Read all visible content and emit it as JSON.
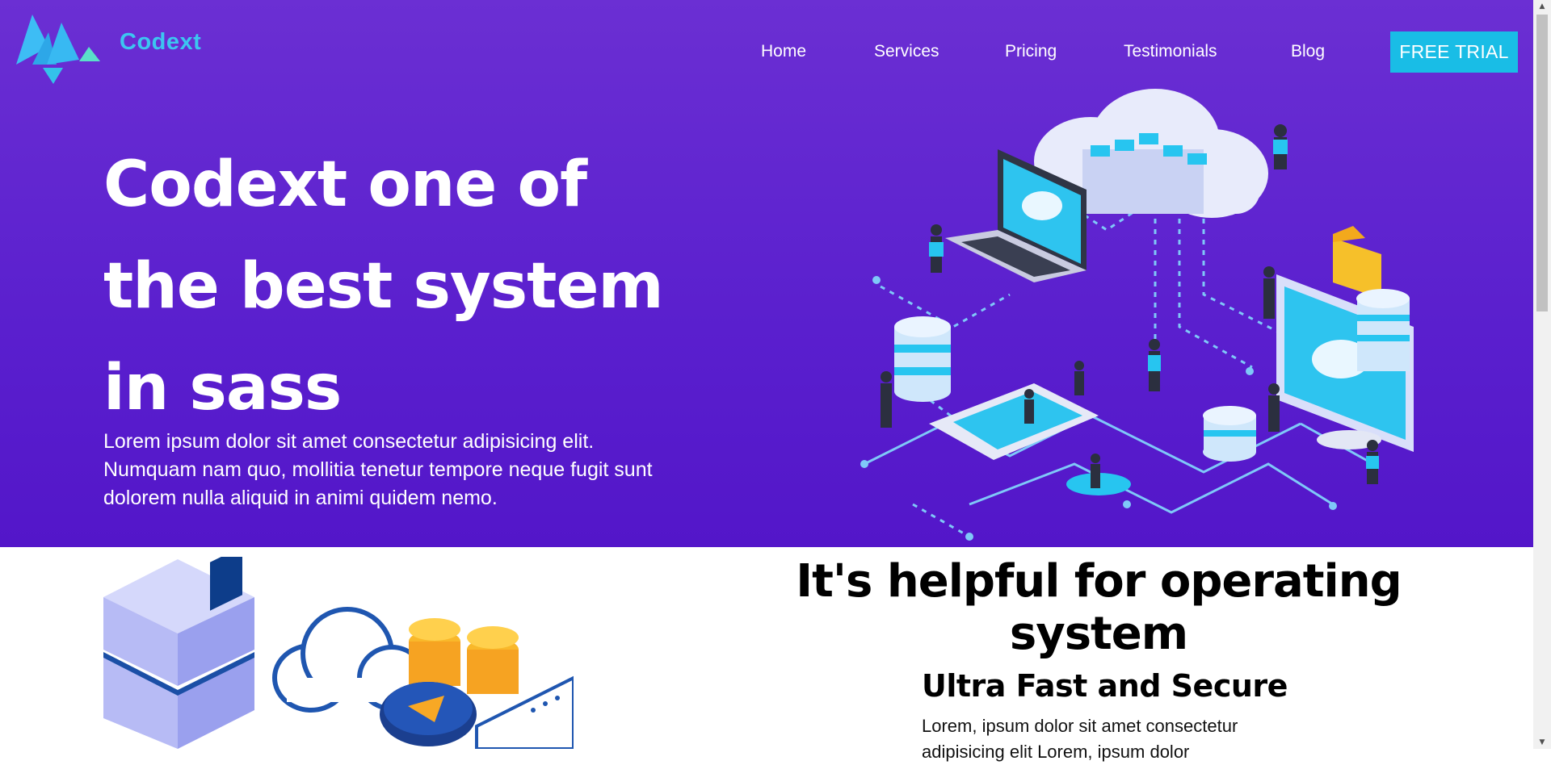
{
  "brand": {
    "name": "Codext"
  },
  "nav": {
    "items": [
      "Home",
      "Services",
      "Pricing",
      "Testimonials",
      "Blog"
    ],
    "cta_label": "FREE TRIAL"
  },
  "hero": {
    "title_line1": "Codext one of",
    "title_line2": "the best system",
    "title_line3": "in sass",
    "description": "Lorem ipsum dolor sit amet consectetur adipisicing elit. Numquam nam quo, mollitia tenetur tempore neque fugit sunt dolorem nulla aliquid in animi quidem nemo."
  },
  "section": {
    "title": "It's helpful for operating system",
    "feature_title": "Ultra Fast and Secure",
    "feature_desc": "Lorem, ipsum dolor sit amet consectetur adipisicing elit Lorem, ipsum dolor"
  },
  "colors": {
    "hero_gradient_top": "#6b2fd3",
    "hero_gradient_bottom": "#5316c9",
    "accent_cyan": "#19bde6",
    "logo_cyan": "#3cc6f0"
  },
  "icons": {
    "logo": "codext-logo-icon",
    "hero_art": "cloud-network-illustration",
    "section_art": "server-cloud-illustration"
  }
}
